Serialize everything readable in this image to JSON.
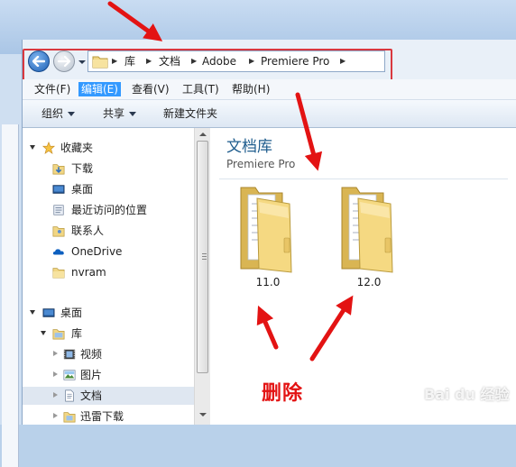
{
  "address": {
    "crumbs": [
      "库",
      "文档",
      "Adobe",
      "Premiere Pro"
    ]
  },
  "menu": {
    "items": [
      "文件(F)",
      "编辑(E)",
      "查看(V)",
      "工具(T)",
      "帮助(H)"
    ],
    "active_index": 1
  },
  "toolbar": {
    "organize": "组织",
    "share": "共享",
    "new_folder": "新建文件夹"
  },
  "nav": {
    "favorites_header": "收藏夹",
    "favorites": [
      "下载",
      "桌面",
      "最近访问的位置",
      "联系人",
      "OneDrive",
      "nvram"
    ],
    "desktop_header": "桌面",
    "library": "库",
    "library_items": [
      "视频",
      "图片",
      "文档",
      "迅雷下载"
    ],
    "selected": "文档"
  },
  "content": {
    "title": "文档库",
    "subtitle": "Premiere Pro",
    "folders": [
      "11.0",
      "12.0"
    ]
  },
  "annotation": {
    "delete_label": "删除",
    "arrow_color": "#e31313",
    "box_color": "#d9383f"
  },
  "watermark": "Bai du 经验",
  "colors": {
    "accent": "#3399ff",
    "title_blue": "#1e5c8d"
  }
}
